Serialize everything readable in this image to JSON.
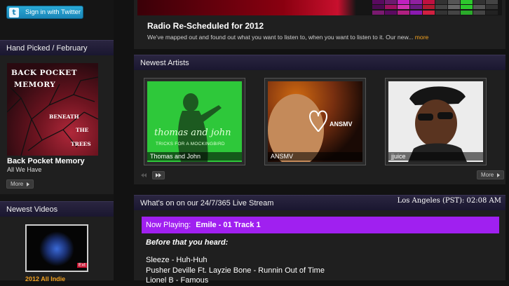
{
  "twitter": {
    "label": "Sign in with Twitter"
  },
  "hand_picked": {
    "header": "Hand Picked / February",
    "cover_line1": "BACK POCKET",
    "cover_line2": "MEMORY",
    "cover_sub1": "BENEATH",
    "cover_sub2": "THE",
    "cover_sub3": "TREES",
    "album": "Back Pocket Memory",
    "artist": "All We Have",
    "more": "More"
  },
  "videos": {
    "header": "Newest Videos",
    "badge": "Ext",
    "title": "2012 All Indie"
  },
  "article": {
    "title": "Radio Re-Scheduled for 2012",
    "desc": "We've mapped out and found out what you want to listen to, when you want to listen to it. Our new...",
    "more": "more"
  },
  "artists": {
    "header": "Newest Artists",
    "items": [
      {
        "name": "Thomas and John",
        "art_line1": "thomas and john",
        "art_line2": "TRICKS FOR A MOCKINGBIRD"
      },
      {
        "name": "ANSMV",
        "art_line1": "ANSMV"
      },
      {
        "name": "jjuice"
      }
    ],
    "more": "More"
  },
  "stream": {
    "header": "What's on on our 24/7/365 Live Stream",
    "time": "Los Angeles (PST): 02:08 AM",
    "now_label": "Now Playing:",
    "now_track": "Emile - 01 Track 1",
    "before_label": "Before that you heard:",
    "history": [
      "Sleeze - Huh-Huh",
      "Pusher Deville Ft. Layzie Bone - Runnin Out of Time",
      "Lionel B - Famous"
    ]
  },
  "colors": {
    "accent_purple": "#a020f0",
    "link_orange": "#f0a020",
    "twitter_blue": "#1a86b8"
  }
}
